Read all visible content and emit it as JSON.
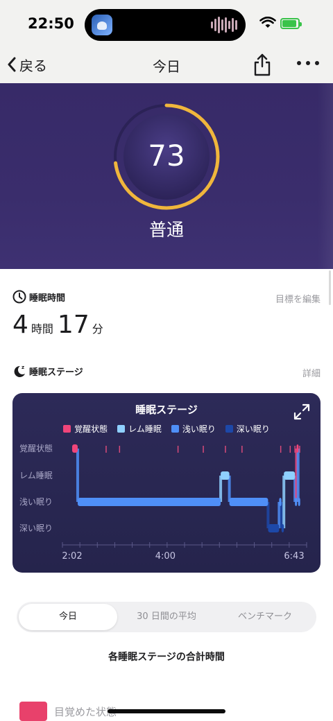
{
  "status_bar": {
    "time": "22:50"
  },
  "nav": {
    "back_label": "戻る",
    "title": "今日"
  },
  "hero": {
    "score": "73",
    "score_label": "普通",
    "score_fraction": 0.73,
    "ring_color": "#f0b63c"
  },
  "sleep_time": {
    "title": "睡眠時間",
    "edit_link": "目標を編集",
    "hours": "4",
    "hours_unit": "時間",
    "minutes": "17",
    "minutes_unit": "分"
  },
  "sleep_stages": {
    "title": "睡眠ステージ",
    "detail_link": "詳細"
  },
  "chart_data": {
    "type": "line",
    "title": "睡眠ステージ",
    "legend": [
      {
        "name": "覚醒状態",
        "color": "#f0457a"
      },
      {
        "name": "レム睡眠",
        "color": "#8fd0ff"
      },
      {
        "name": "浅い眠り",
        "color": "#4f8ff7"
      },
      {
        "name": "深い眠り",
        "color": "#1d48a8"
      }
    ],
    "y_categories": [
      "覚醒状態",
      "レム睡眠",
      "浅い眠り",
      "深い眠り"
    ],
    "x_ticks": [
      "2:02",
      "4:00",
      "6:43"
    ],
    "x_range": [
      "2:02",
      "6:43"
    ],
    "segments": [
      {
        "stage": "覚醒状態",
        "start": "2:02",
        "end": "2:09"
      },
      {
        "stage": "浅い眠り",
        "start": "2:09",
        "end": "5:10"
      },
      {
        "stage": "レム睡眠",
        "start": "5:10",
        "end": "5:21"
      },
      {
        "stage": "浅い眠り",
        "start": "5:21",
        "end": "6:10"
      },
      {
        "stage": "深い眠り",
        "start": "6:10",
        "end": "6:24"
      },
      {
        "stage": "浅い眠り",
        "start": "6:24",
        "end": "6:27"
      },
      {
        "stage": "深い眠り",
        "start": "6:27",
        "end": "6:30"
      },
      {
        "stage": "レム睡眠",
        "start": "6:30",
        "end": "6:44"
      },
      {
        "stage": "浅い眠り",
        "start": "6:44",
        "end": "6:46"
      },
      {
        "stage": "覚醒状態",
        "start": "6:46",
        "end": "6:48"
      },
      {
        "stage": "浅い眠り",
        "start": "6:48",
        "end": "6:50"
      }
    ],
    "brief_awakenings": [
      "2:45",
      "3:02",
      "4:16",
      "4:48",
      "5:16",
      "5:37",
      "6:26",
      "6:38",
      "6:44",
      "6:50"
    ]
  },
  "tabs": [
    {
      "label": "今日",
      "active": true
    },
    {
      "label": "30 日間の平均",
      "active": false
    },
    {
      "label": "ベンチマーク",
      "active": false
    }
  ],
  "totals": {
    "title": "各睡眠ステージの合計時間"
  },
  "stage_rows": [
    {
      "label": "目覚めた状態",
      "color": "#e8416b"
    }
  ]
}
